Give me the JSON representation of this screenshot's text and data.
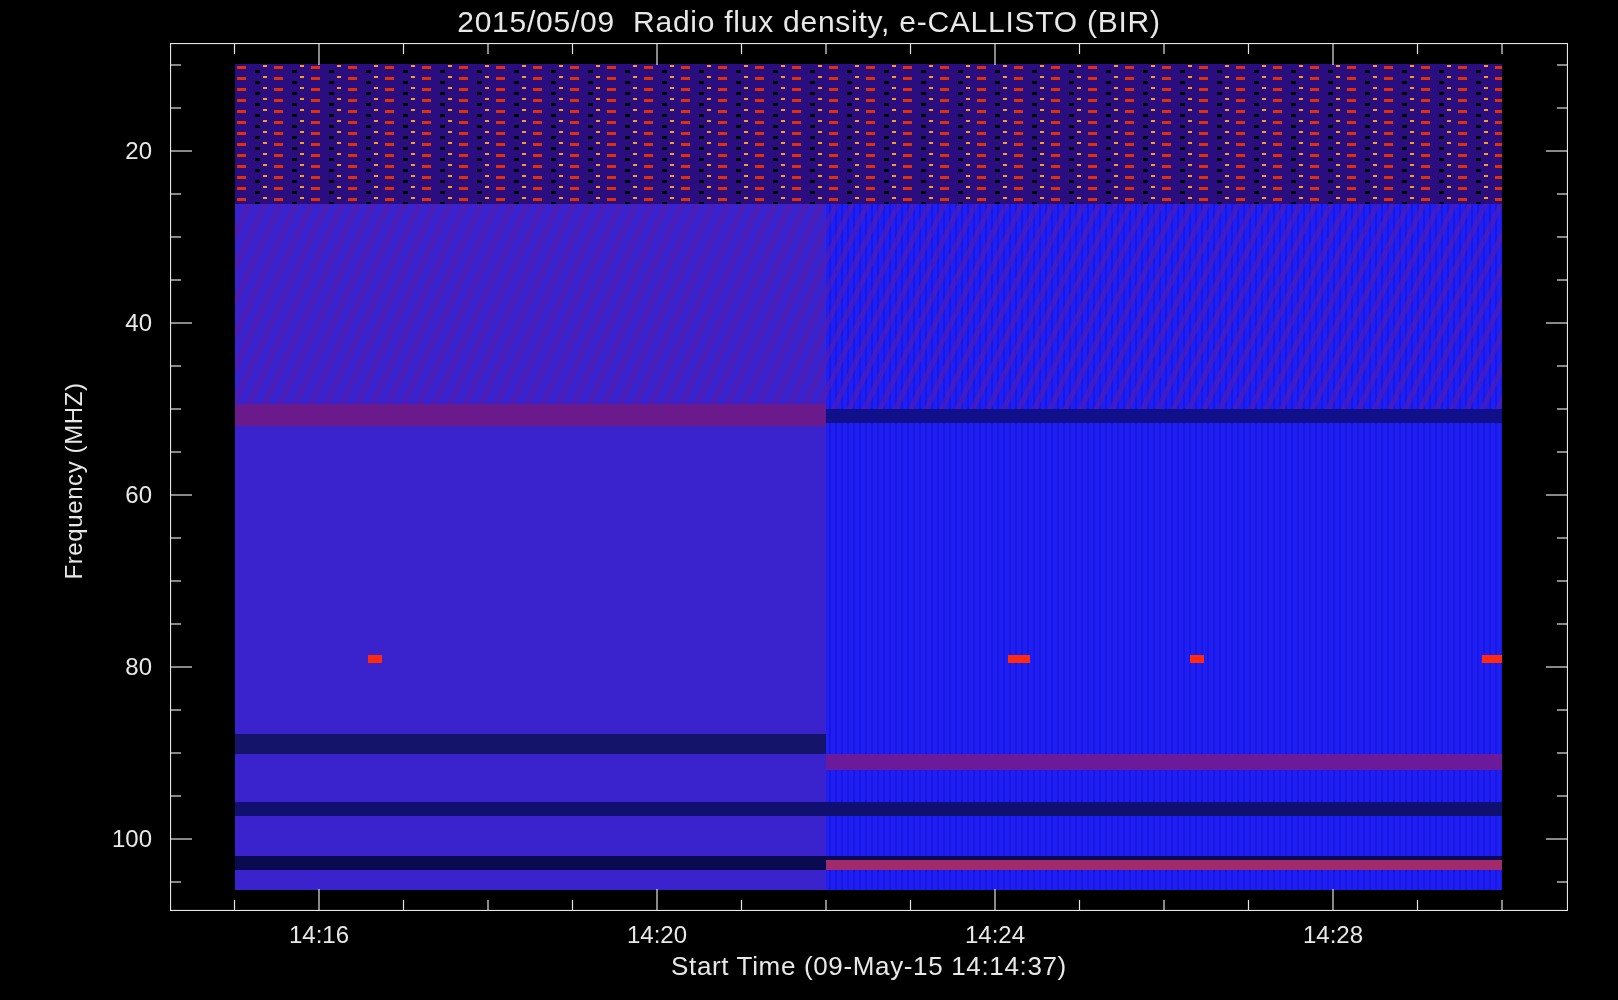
{
  "title": "2015/05/09  Radio flux density, e-CALLISTO (BIR)",
  "y_axis": {
    "label": "Frequency (MHZ)",
    "ticks": [
      "20",
      "40",
      "60",
      "80",
      "100"
    ]
  },
  "x_axis": {
    "label": "Start Time (09-May-15 14:14:37)",
    "ticks": [
      "14:16",
      "14:20",
      "14:24",
      "14:28"
    ]
  }
}
